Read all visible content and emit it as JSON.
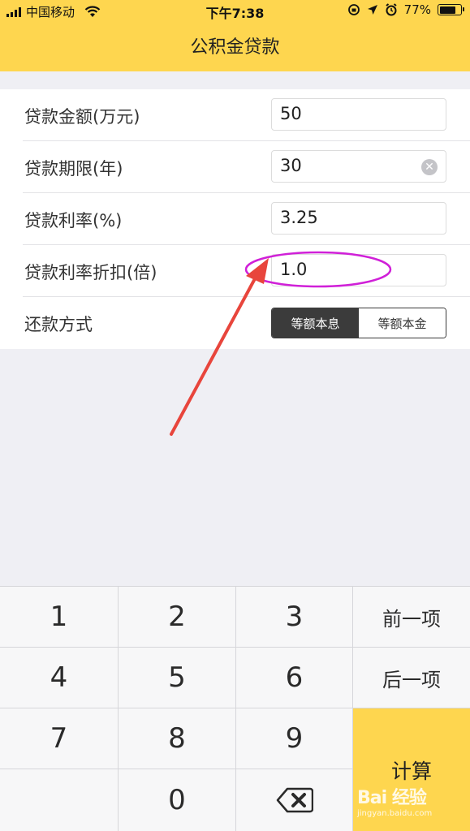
{
  "status_bar": {
    "carrier": "中国移动",
    "time": "下午7:38",
    "battery_percent": "77%",
    "battery_level": 0.77
  },
  "nav": {
    "title": "公积金贷款"
  },
  "form": {
    "rows": [
      {
        "label": "贷款金额(万元)",
        "value": "50"
      },
      {
        "label": "贷款期限(年)",
        "value": "30"
      },
      {
        "label": "贷款利率(%)",
        "value": "3.25"
      },
      {
        "label": "贷款利率折扣(倍)",
        "value": "1.0"
      }
    ],
    "repayment": {
      "label": "还款方式",
      "options": [
        "等额本息",
        "等额本金"
      ],
      "selected": "等额本息"
    }
  },
  "keypad": {
    "digits": [
      "1",
      "2",
      "3",
      "4",
      "5",
      "6",
      "7",
      "8",
      "9",
      "0"
    ],
    "prev_label": "前一项",
    "next_label": "后一项",
    "calc_label": "计算"
  },
  "watermark": {
    "brand": "Bai 经验",
    "url": "jingyan.baidu.com"
  },
  "colors": {
    "accent": "#fed64f",
    "annotation_arrow": "#e8453c",
    "annotation_ellipse": "#d020d8"
  }
}
